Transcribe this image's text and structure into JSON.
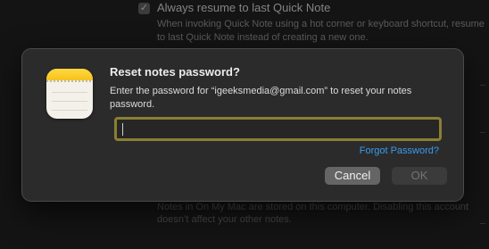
{
  "background": {
    "checkbox_label": "Always resume to last Quick Note",
    "checkbox_mark": "✓",
    "checkbox_description": "When invoking Quick Note using a hot corner or keyboard shortcut, resume to last Quick Note instead of creating a new one.",
    "footer_text": "Notes in On My Mac are stored on this computer. Disabling this account doesn’t affect your other notes."
  },
  "dialog": {
    "app_icon": "notes-app-icon",
    "title": "Reset notes password?",
    "message": "Enter the password for “igeeksmedia@gmail.com” to reset your notes password.",
    "password_value": "",
    "forgot_label": "Forgot Password?",
    "cancel_label": "Cancel",
    "ok_label": "OK"
  },
  "colors": {
    "focus_ring": "#8a7f34",
    "link": "#3a9bf0",
    "sheet_background": "#2b2b2b"
  }
}
